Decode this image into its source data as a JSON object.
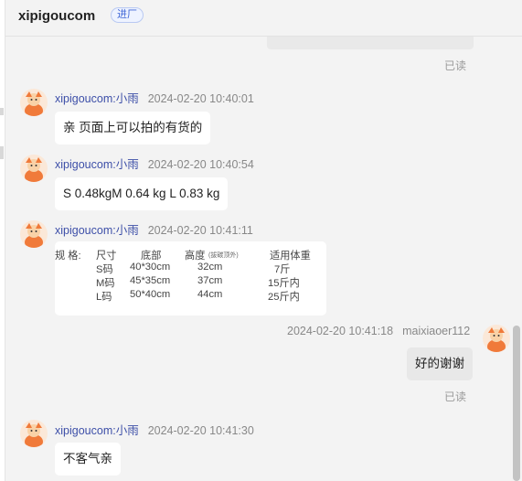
{
  "header": {
    "title": "xipigoucom",
    "badge": "进厂"
  },
  "previous": {
    "fragments": [
      "'",
      "'"
    ],
    "read_status": "已读"
  },
  "messages": [
    {
      "sender": "xipigoucom:小雨",
      "time": "2024-02-20 10:40:01",
      "text": "亲 页面上可以拍的有货的"
    },
    {
      "sender": "xipigoucom:小雨",
      "time": "2024-02-20 10:40:54",
      "text": "S 0.48kgM 0.64 kg L  0.83 kg"
    },
    {
      "sender": "xipigoucom:小雨",
      "time": "2024-02-20 10:41:11"
    },
    {
      "sender": "maixiaoer112",
      "time": "2024-02-20 10:41:18",
      "text": "好的谢谢",
      "read_status": "已读"
    },
    {
      "sender": "xipigoucom:小雨",
      "time": "2024-02-20 10:41:30",
      "text": "不客气亲"
    }
  ],
  "size_table": {
    "label": "规   格:",
    "headers": [
      "尺寸",
      "底部",
      "高度",
      "(拔碳顶外)",
      "适用体重"
    ],
    "rows": [
      [
        "S码",
        "40*30cm",
        "32cm",
        "7斤"
      ],
      [
        "M码",
        "45*35cm",
        "37cm",
        "15斤内"
      ],
      [
        "L码",
        "50*40cm",
        "44cm",
        "25斤内"
      ]
    ]
  },
  "colors": {
    "background": "#f3f3f3",
    "bubble_in": "#ffffff",
    "bubble_out": "#e8e8e8",
    "sender_name": "#3d4fa8",
    "badge": "#3f66d6",
    "avatar": "#f07a3a"
  },
  "icons": {
    "avatar": "cartoon-mascot-icon"
  }
}
